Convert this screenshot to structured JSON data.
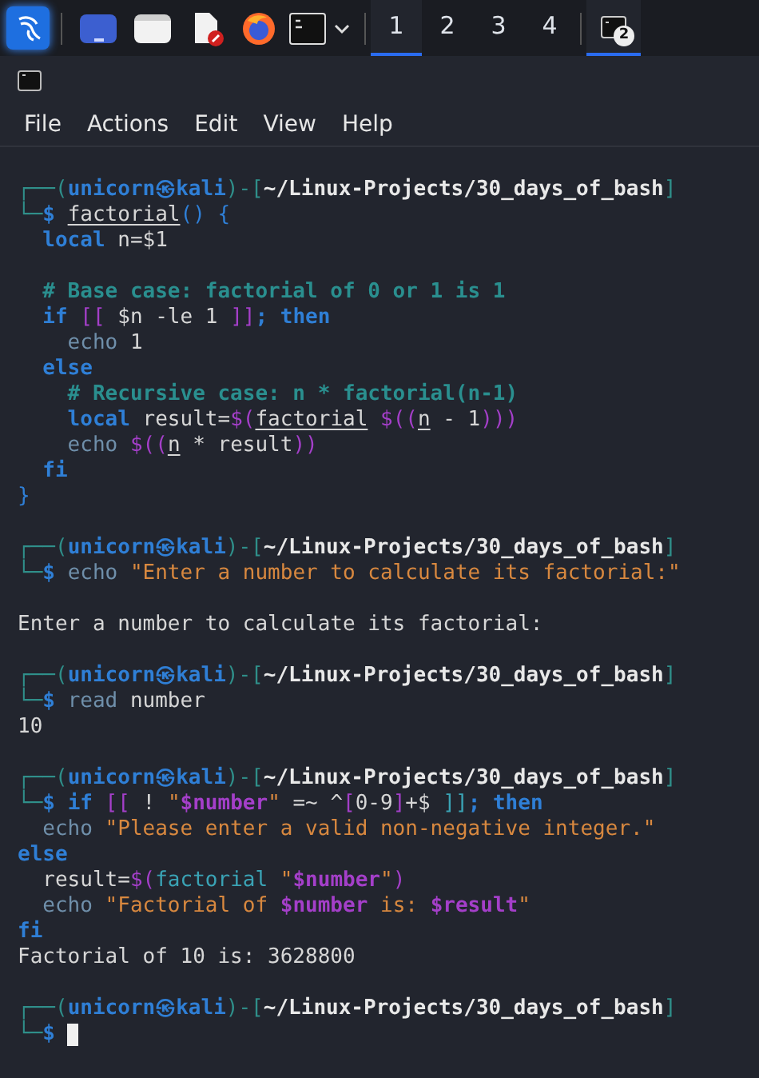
{
  "taskbar": {
    "workspaces": [
      {
        "label": "1",
        "selected": true
      },
      {
        "label": "2",
        "selected": false
      },
      {
        "label": "3",
        "selected": false
      },
      {
        "label": "4",
        "selected": false
      }
    ],
    "task": {
      "badge": "2",
      "selected": true
    }
  },
  "window": {
    "menu": [
      "File",
      "Actions",
      "Edit",
      "View",
      "Help"
    ]
  },
  "terminal": {
    "cursor_visible": true,
    "lines": [
      {
        "kind": "prompt",
        "segments": [
          {
            "text": "┌──(",
            "kind": "frame"
          },
          {
            "text": "unicorn㉿kali",
            "kind": "user"
          },
          {
            "text": ")-[",
            "kind": "frame"
          },
          {
            "text": "~/Linux-Projects/30_days_of_bash",
            "kind": "path"
          },
          {
            "text": "]",
            "kind": "frame"
          }
        ]
      },
      {
        "kind": "code",
        "segments": [
          {
            "text": "└─",
            "kind": "frame"
          },
          {
            "text": "$ ",
            "kind": "dollar"
          },
          {
            "text": "factorial",
            "kind": "func"
          },
          {
            "text": "() {",
            "kind": "punct"
          }
        ]
      },
      {
        "kind": "code",
        "segments": [
          {
            "text": "  local",
            "kind": "keyword"
          },
          {
            "text": " n=$1",
            "kind": "plain"
          }
        ]
      },
      {
        "kind": "blank"
      },
      {
        "kind": "code",
        "segments": [
          {
            "text": "  # Base case: factorial of 0 or 1 is 1",
            "kind": "comment"
          }
        ]
      },
      {
        "kind": "code",
        "segments": [
          {
            "text": "  if ",
            "kind": "keyword"
          },
          {
            "text": "[[",
            "kind": "bracket"
          },
          {
            "text": " $n -le 1 ",
            "kind": "plain"
          },
          {
            "text": "]]",
            "kind": "bracket"
          },
          {
            "text": "; then",
            "kind": "keyword"
          }
        ]
      },
      {
        "kind": "code",
        "segments": [
          {
            "text": "    echo",
            "kind": "builtin"
          },
          {
            "text": " 1",
            "kind": "plain"
          }
        ]
      },
      {
        "kind": "code",
        "segments": [
          {
            "text": "  else",
            "kind": "keyword"
          }
        ]
      },
      {
        "kind": "code",
        "segments": [
          {
            "text": "    # Recursive case: n * factorial(n-1)",
            "kind": "comment"
          }
        ]
      },
      {
        "kind": "code",
        "segments": [
          {
            "text": "    local",
            "kind": "keyword"
          },
          {
            "text": " result=",
            "kind": "plain"
          },
          {
            "text": "$(",
            "kind": "bracket"
          },
          {
            "text": "factorial",
            "kind": "func"
          },
          {
            "text": " $((",
            "kind": "bracket"
          },
          {
            "text": "n",
            "kind": "func"
          },
          {
            "text": " - 1",
            "kind": "plain"
          },
          {
            "text": ")))",
            "kind": "bracket"
          }
        ]
      },
      {
        "kind": "code",
        "segments": [
          {
            "text": "    echo",
            "kind": "builtin"
          },
          {
            "text": " $((",
            "kind": "bracket"
          },
          {
            "text": "n",
            "kind": "func"
          },
          {
            "text": " * result",
            "kind": "plain"
          },
          {
            "text": "))",
            "kind": "bracket"
          }
        ]
      },
      {
        "kind": "code",
        "segments": [
          {
            "text": "  fi",
            "kind": "keyword"
          }
        ]
      },
      {
        "kind": "code",
        "segments": [
          {
            "text": "}",
            "kind": "punct"
          }
        ]
      },
      {
        "kind": "blank"
      },
      {
        "kind": "prompt",
        "segments": [
          {
            "text": "┌──(",
            "kind": "frame"
          },
          {
            "text": "unicorn㉿kali",
            "kind": "user"
          },
          {
            "text": ")-[",
            "kind": "frame"
          },
          {
            "text": "~/Linux-Projects/30_days_of_bash",
            "kind": "path"
          },
          {
            "text": "]",
            "kind": "frame"
          }
        ]
      },
      {
        "kind": "code",
        "segments": [
          {
            "text": "└─",
            "kind": "frame"
          },
          {
            "text": "$ ",
            "kind": "dollar"
          },
          {
            "text": "echo",
            "kind": "builtin"
          },
          {
            "text": " \"Enter a number to calculate its factorial:\"",
            "kind": "string"
          }
        ]
      },
      {
        "kind": "blank"
      },
      {
        "kind": "output",
        "segments": [
          {
            "text": "Enter a number to calculate its factorial:",
            "kind": "plain"
          }
        ]
      },
      {
        "kind": "blank"
      },
      {
        "kind": "prompt",
        "segments": [
          {
            "text": "┌──(",
            "kind": "frame"
          },
          {
            "text": "unicorn㉿kali",
            "kind": "user"
          },
          {
            "text": ")-[",
            "kind": "frame"
          },
          {
            "text": "~/Linux-Projects/30_days_of_bash",
            "kind": "path"
          },
          {
            "text": "]",
            "kind": "frame"
          }
        ]
      },
      {
        "kind": "code",
        "segments": [
          {
            "text": "└─",
            "kind": "frame"
          },
          {
            "text": "$ ",
            "kind": "dollar"
          },
          {
            "text": "read",
            "kind": "builtin"
          },
          {
            "text": " number",
            "kind": "plain"
          }
        ]
      },
      {
        "kind": "output",
        "segments": [
          {
            "text": "10",
            "kind": "plain"
          }
        ]
      },
      {
        "kind": "blank"
      },
      {
        "kind": "prompt",
        "segments": [
          {
            "text": "┌──(",
            "kind": "frame"
          },
          {
            "text": "unicorn㉿kali",
            "kind": "user"
          },
          {
            "text": ")-[",
            "kind": "frame"
          },
          {
            "text": "~/Linux-Projects/30_days_of_bash",
            "kind": "path"
          },
          {
            "text": "]",
            "kind": "frame"
          }
        ]
      },
      {
        "kind": "code",
        "segments": [
          {
            "text": "└─",
            "kind": "frame"
          },
          {
            "text": "$ ",
            "kind": "dollar"
          },
          {
            "text": "if ",
            "kind": "keyword"
          },
          {
            "text": "[[",
            "kind": "bracket"
          },
          {
            "text": " ! ",
            "kind": "plain"
          },
          {
            "text": "\"",
            "kind": "string"
          },
          {
            "text": "$number",
            "kind": "var"
          },
          {
            "text": "\"",
            "kind": "string"
          },
          {
            "text": " =~ ^",
            "kind": "plain"
          },
          {
            "text": "[",
            "kind": "bracket"
          },
          {
            "text": "0-9",
            "kind": "plain"
          },
          {
            "text": "]",
            "kind": "bracket"
          },
          {
            "text": "+$ ",
            "kind": "plain"
          },
          {
            "text": "]]",
            "kind": "command"
          },
          {
            "text": "; then",
            "kind": "keyword"
          }
        ]
      },
      {
        "kind": "code",
        "segments": [
          {
            "text": "  echo",
            "kind": "builtin"
          },
          {
            "text": " \"Please enter a valid non-negative integer.\"",
            "kind": "string"
          }
        ]
      },
      {
        "kind": "code",
        "segments": [
          {
            "text": "else",
            "kind": "keyword"
          }
        ]
      },
      {
        "kind": "code",
        "segments": [
          {
            "text": "  result=",
            "kind": "plain"
          },
          {
            "text": "$(",
            "kind": "bracket"
          },
          {
            "text": "factorial",
            "kind": "command"
          },
          {
            "text": " \"",
            "kind": "string"
          },
          {
            "text": "$number",
            "kind": "var"
          },
          {
            "text": "\"",
            "kind": "string"
          },
          {
            "text": ")",
            "kind": "bracket"
          }
        ]
      },
      {
        "kind": "code",
        "segments": [
          {
            "text": "  echo",
            "kind": "builtin"
          },
          {
            "text": " \"Factorial of ",
            "kind": "string"
          },
          {
            "text": "$number",
            "kind": "var"
          },
          {
            "text": " is: ",
            "kind": "string"
          },
          {
            "text": "$result",
            "kind": "var"
          },
          {
            "text": "\"",
            "kind": "string"
          }
        ]
      },
      {
        "kind": "code",
        "segments": [
          {
            "text": "fi",
            "kind": "keyword"
          }
        ]
      },
      {
        "kind": "output",
        "segments": [
          {
            "text": "Factorial of 10 is: 3628800",
            "kind": "plain"
          }
        ]
      },
      {
        "kind": "blank"
      },
      {
        "kind": "prompt",
        "segments": [
          {
            "text": "┌──(",
            "kind": "frame"
          },
          {
            "text": "unicorn㉿kali",
            "kind": "user"
          },
          {
            "text": ")-[",
            "kind": "frame"
          },
          {
            "text": "~/Linux-Projects/30_days_of_bash",
            "kind": "path"
          },
          {
            "text": "]",
            "kind": "frame"
          }
        ]
      },
      {
        "kind": "code",
        "segments": [
          {
            "text": "└─",
            "kind": "frame"
          },
          {
            "text": "$",
            "kind": "dollar"
          }
        ]
      }
    ]
  }
}
